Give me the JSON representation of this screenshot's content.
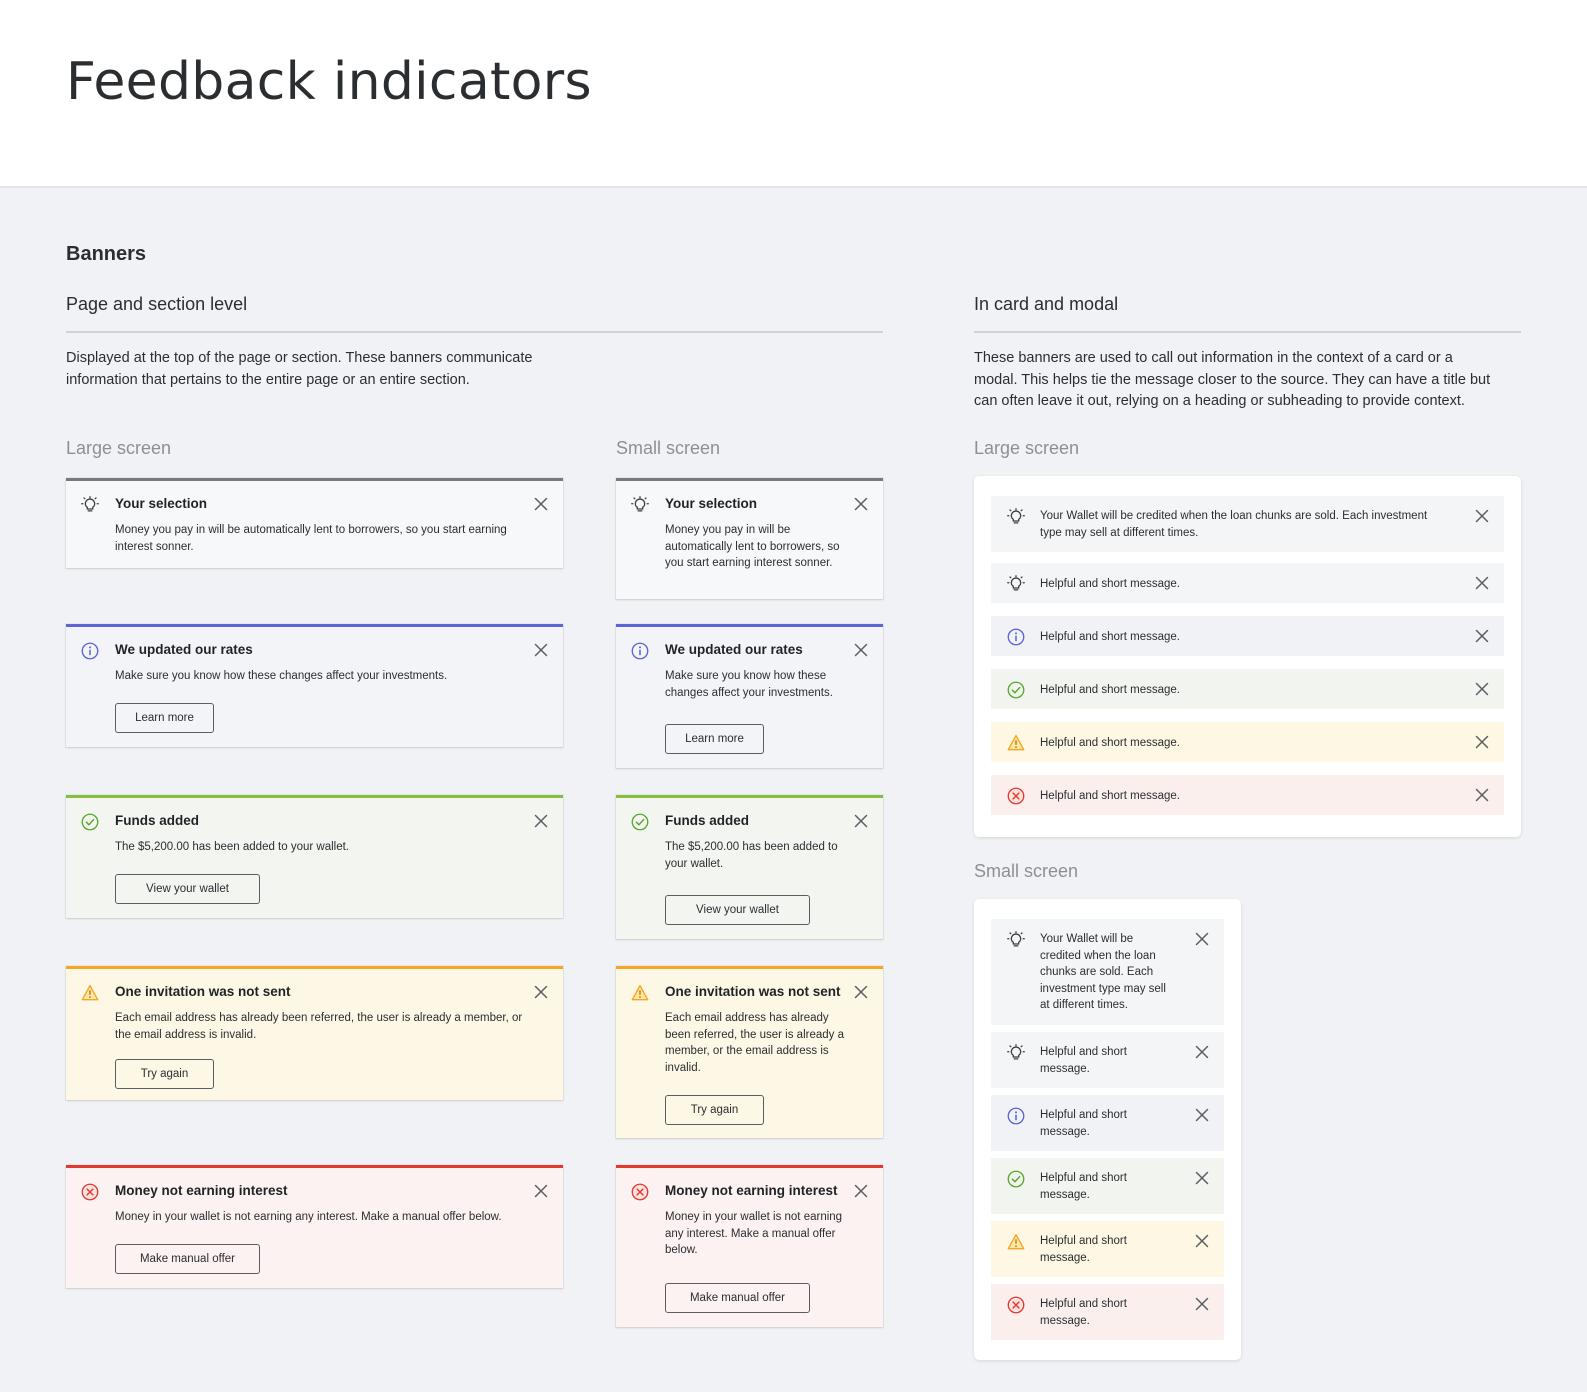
{
  "page": {
    "title": "Feedback indicators"
  },
  "banners_section": {
    "title": "Banners",
    "page_level": {
      "title": "Page and section level",
      "description_line1": "Displayed at the top of the page or section. These banners communicate",
      "description_line2": "information that pertains to the entire page or an entire section.",
      "large_label": "Large screen",
      "small_label": "Small screen",
      "banners": [
        {
          "variant": "neutral",
          "icon": "lightbulb-icon",
          "title": "Your selection",
          "text": "Money you pay in will be automatically lent to borrowers, so you start earning interest sonner.",
          "button": ""
        },
        {
          "variant": "info",
          "icon": "info-icon",
          "title": "We updated our rates",
          "text": "Make sure you know how these changes affect your investments.",
          "button": "Learn more"
        },
        {
          "variant": "success",
          "icon": "check-circle-icon",
          "title": "Funds added",
          "text": "The $5,200.00 has been added to your wallet.",
          "button": "View your wallet"
        },
        {
          "variant": "warning",
          "icon": "warning-icon",
          "title": "One invitation was not sent",
          "text": "Each email address has already been referred, the user is already a member, or the email address is invalid.",
          "button": "Try again"
        },
        {
          "variant": "error",
          "icon": "error-circle-icon",
          "title": "Money not earning interest",
          "text": "Money in your wallet is not earning any interest. Make a manual offer below.",
          "button": "Make manual offer"
        }
      ]
    },
    "card_modal": {
      "title": "In card and modal",
      "description_line1": "These banners are used to call out information in the context of a card or a",
      "description_line2": "modal. This helps tie the message closer to the source. They can have a title but",
      "description_line3": "can often leave it out, relying on a heading or subheading to provide context.",
      "large_label": "Large screen",
      "small_label": "Small screen",
      "banners": [
        {
          "variant": "neutral",
          "icon": "lightbulb-icon",
          "text": "Your Wallet will be credited when the loan chunks are sold. Each investment type may sell at different times."
        },
        {
          "variant": "neutral2",
          "icon": "lightbulb-icon",
          "text": "Helpful and short message."
        },
        {
          "variant": "info",
          "icon": "info-icon",
          "text": "Helpful and short message."
        },
        {
          "variant": "success",
          "icon": "check-circle-icon",
          "text": "Helpful and short message."
        },
        {
          "variant": "warning",
          "icon": "warning-icon",
          "text": "Helpful and short message."
        },
        {
          "variant": "error",
          "icon": "error-circle-icon",
          "text": "Helpful and short message."
        }
      ]
    }
  },
  "colors": {
    "neutral": "#77797c",
    "info": "#5c64d6",
    "success": "#86bf3e",
    "warning": "#f5a623",
    "error": "#e13b30"
  }
}
